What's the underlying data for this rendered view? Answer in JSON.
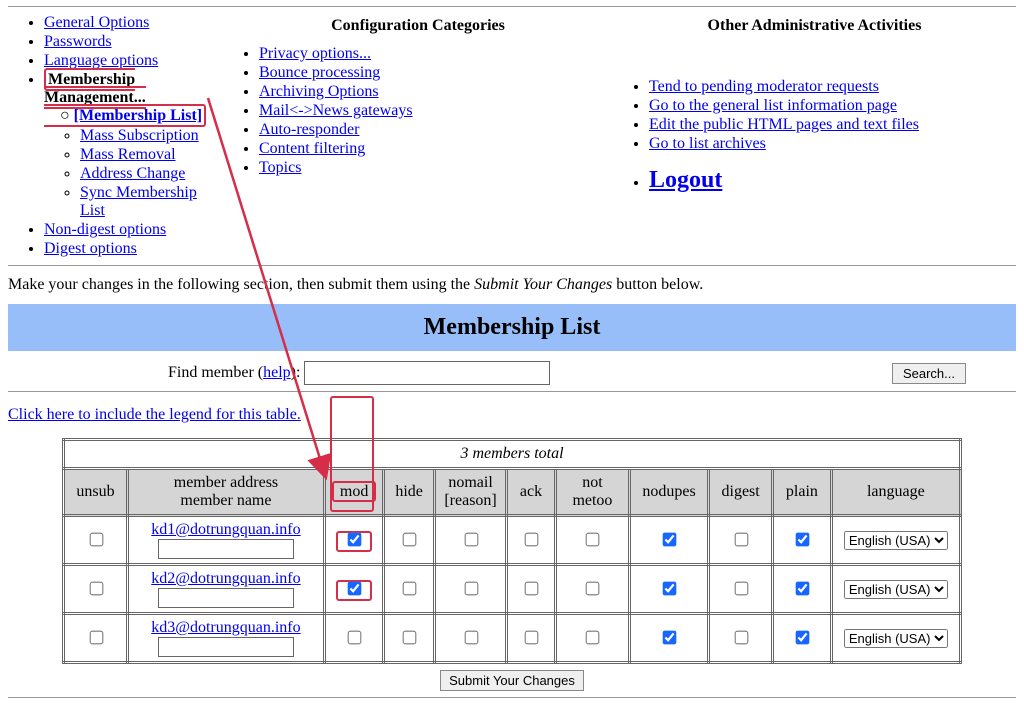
{
  "headings": {
    "config": "Configuration Categories",
    "other": "Other Administrative Activities"
  },
  "nav1": {
    "general": "General Options",
    "passwords": "Passwords",
    "lang": "Language options",
    "mm": "Membership Management...",
    "mlist": "[Membership List]",
    "mass_sub": "Mass Subscription",
    "mass_rem": "Mass Removal",
    "addr": "Address Change",
    "sync": "Sync Membership List",
    "nondigest": "Non-digest options",
    "digest": "Digest options"
  },
  "nav2": {
    "privacy": "Privacy options...",
    "bounce": "Bounce processing",
    "archiving": "Archiving Options",
    "gateways": "Mail<->News gateways",
    "autoresp": "Auto-responder",
    "filter": "Content filtering",
    "topics": "Topics"
  },
  "nav3": {
    "pending": "Tend to pending moderator requests",
    "general": "Go to the general list information page",
    "edit": "Edit the public HTML pages and text files",
    "archives": "Go to list archives",
    "logout": "Logout"
  },
  "instructions": {
    "pre": "Make your changes in the following section, then submit them using the ",
    "em": "Submit Your Changes",
    "post": " button below."
  },
  "banner": "Membership List",
  "find": {
    "label_pre": "Find member (",
    "help": "help",
    "label_post": "):"
  },
  "search_btn": "Search...",
  "legend_link": "Click here to include the legend for this table.",
  "table": {
    "caption": "3 members total",
    "cols": {
      "unsub": "unsub",
      "member_addr": "member address",
      "member_name": "member name",
      "mod": "mod",
      "hide": "hide",
      "nomail": "nomail",
      "reason": "[reason]",
      "ack": "ack",
      "notmetoo": "not metoo",
      "nodupes": "nodupes",
      "digest": "digest",
      "plain": "plain",
      "language": "language"
    },
    "lang_option": "English (USA)",
    "rows": [
      {
        "email": "kd1@dotrungquan.info",
        "mod": true,
        "hide": false,
        "nomail": false,
        "ack": false,
        "notmetoo": false,
        "nodupes": true,
        "digest": false,
        "plain": true
      },
      {
        "email": "kd2@dotrungquan.info",
        "mod": true,
        "hide": false,
        "nomail": false,
        "ack": false,
        "notmetoo": false,
        "nodupes": true,
        "digest": false,
        "plain": true
      },
      {
        "email": "kd3@dotrungquan.info",
        "mod": false,
        "hide": false,
        "nomail": false,
        "ack": false,
        "notmetoo": false,
        "nodupes": true,
        "digest": false,
        "plain": true
      }
    ]
  },
  "submit": "Submit Your Changes"
}
